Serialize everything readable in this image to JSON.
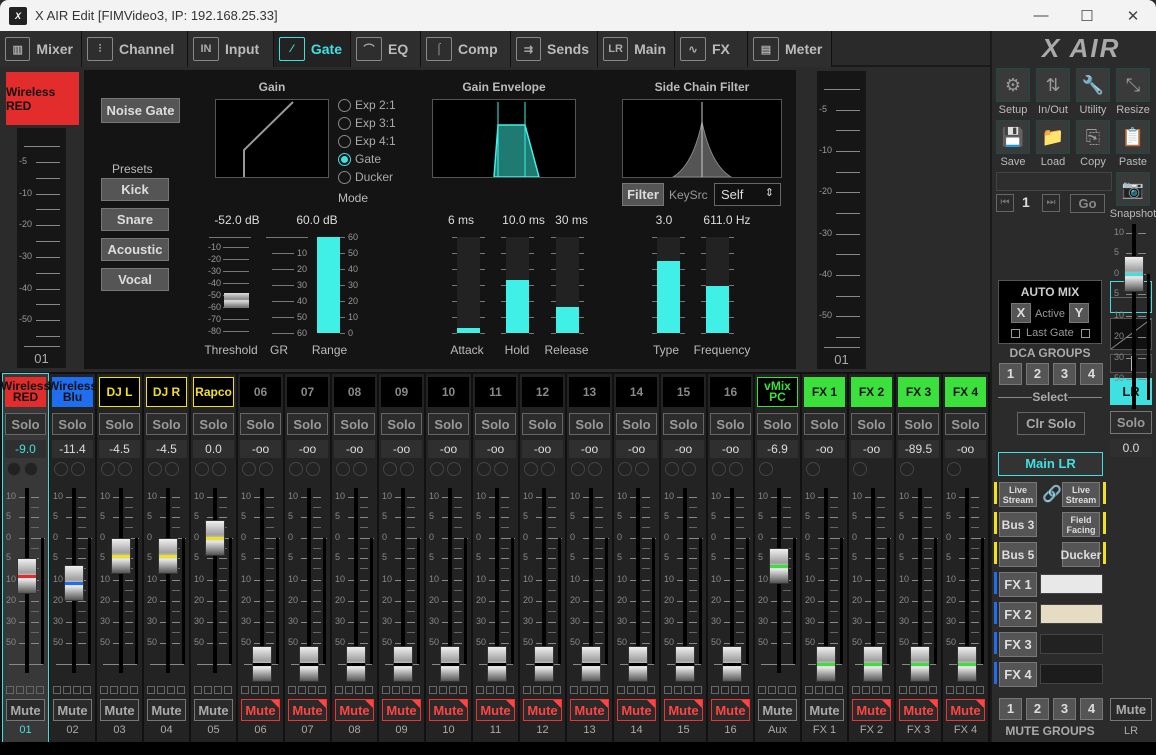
{
  "window": {
    "title": "X AIR Edit [FIMVideo3, IP: 192.168.25.33]",
    "minimize": "—",
    "maximize": "☐",
    "close": "✕"
  },
  "tabs": [
    {
      "label": "Mixer",
      "icon": "mixer-icon",
      "glyph": "▥"
    },
    {
      "label": "Channel",
      "icon": "channel-icon",
      "glyph": "⫶"
    },
    {
      "label": "Input",
      "icon": "input-icon",
      "glyph": "IN"
    },
    {
      "label": "Gate",
      "icon": "gate-icon",
      "glyph": "⁄",
      "active": true
    },
    {
      "label": "EQ",
      "icon": "eq-icon",
      "glyph": "⌒"
    },
    {
      "label": "Comp",
      "icon": "comp-icon",
      "glyph": "⌠"
    },
    {
      "label": "Sends",
      "icon": "sends-icon",
      "glyph": "⇉"
    },
    {
      "label": "Main",
      "icon": "main-icon",
      "glyph": "LR"
    },
    {
      "label": "FX",
      "icon": "fx-icon",
      "glyph": "∿"
    },
    {
      "label": "Meter",
      "icon": "meter-icon",
      "glyph": "▤"
    }
  ],
  "channel": {
    "name": "Wireless RED",
    "number": "01",
    "color": "#e32d2d"
  },
  "meter_scale": [
    "-5",
    "-10",
    "-20",
    "-30",
    "-40",
    "-50"
  ],
  "gate": {
    "noise_gate_label": "Noise Gate",
    "presets_label": "Presets",
    "presets": [
      "Kick",
      "Snare",
      "Acoustic",
      "Vocal"
    ],
    "gain_title": "Gain",
    "envelope_title": "Gain Envelope",
    "sidechain_title": "Side Chain Filter",
    "modes": [
      "Exp 2:1",
      "Exp 3:1",
      "Exp 4:1",
      "Gate",
      "Ducker"
    ],
    "mode_selected": "Gate",
    "mode_label": "Mode",
    "threshold": {
      "label": "Threshold",
      "value": "-52.0 dB",
      "scale": [
        "-10",
        "-20",
        "-30",
        "-40",
        "-50",
        "-60",
        "-70",
        "-80"
      ]
    },
    "gr": {
      "label": "GR",
      "scale": [
        "10",
        "20",
        "30",
        "40",
        "50",
        "60"
      ]
    },
    "range": {
      "label": "Range",
      "value": "60.0 dB",
      "fraction": 1.0,
      "scale": [
        "60",
        "50",
        "40",
        "30",
        "20",
        "10",
        "0"
      ]
    },
    "attack": {
      "label": "Attack",
      "value": "6 ms",
      "fraction": 0.05
    },
    "hold": {
      "label": "Hold",
      "value": "10.0 ms",
      "fraction": 0.55
    },
    "release": {
      "label": "Release",
      "value": "30 ms",
      "fraction": 0.27
    },
    "filter_label": "Filter",
    "keysrc_label": "KeySrc",
    "keysrc_value": "Self",
    "type": {
      "label": "Type",
      "value": "3.0",
      "fraction": 0.75
    },
    "frequency": {
      "label": "Frequency",
      "value": "611.0 Hz",
      "fraction": 0.49
    }
  },
  "strips": [
    {
      "name": "Wireless RED",
      "db": "-9.0",
      "num": "01",
      "color": "#e32d2d",
      "text": "#111",
      "mute": false,
      "sel": true,
      "fader_db": -9.0,
      "stripe": "#e32d2d",
      "knobs": 2,
      "knobfill": true
    },
    {
      "name": "Wireless Blu",
      "db": "-11.4",
      "num": "02",
      "color": "#1f6ef0",
      "text": "#111",
      "mute": false,
      "fader_db": -11.4,
      "stripe": "#1f6ef0",
      "knobs": 2
    },
    {
      "name": "DJ L",
      "db": "-4.5",
      "num": "03",
      "color": "#000",
      "text": "#f0e020",
      "border": "#f0e020",
      "mute": false,
      "fader_db": -4.5,
      "stripe": "#f0e020",
      "knobs": 2
    },
    {
      "name": "DJ R",
      "db": "-4.5",
      "num": "04",
      "color": "#000",
      "text": "#f0e020",
      "border": "#f0e020",
      "mute": false,
      "fader_db": -4.5,
      "stripe": "#f0e020",
      "knobs": 2
    },
    {
      "name": "Rapco",
      "db": "0.0",
      "num": "05",
      "color": "#000",
      "text": "#f0e020",
      "border": "#f0e020",
      "mute": false,
      "fader_db": 0,
      "stripe": "#f0e020",
      "knobs": 2
    },
    {
      "name": "06",
      "db": "-oo",
      "num": "06",
      "mute": true,
      "fader_db": -90,
      "stripe": "#000",
      "knobs": 2
    },
    {
      "name": "07",
      "db": "-oo",
      "num": "07",
      "mute": true,
      "fader_db": -90,
      "stripe": "#000",
      "knobs": 2
    },
    {
      "name": "08",
      "db": "-oo",
      "num": "08",
      "mute": true,
      "fader_db": -90,
      "stripe": "#000",
      "knobs": 2
    },
    {
      "name": "09",
      "db": "-oo",
      "num": "09",
      "mute": true,
      "fader_db": -90,
      "stripe": "#000",
      "knobs": 2
    },
    {
      "name": "10",
      "db": "-oo",
      "num": "10",
      "mute": true,
      "fader_db": -90,
      "stripe": "#000",
      "knobs": 2
    },
    {
      "name": "11",
      "db": "-oo",
      "num": "11",
      "mute": true,
      "fader_db": -90,
      "stripe": "#000",
      "knobs": 2
    },
    {
      "name": "12",
      "db": "-oo",
      "num": "12",
      "mute": true,
      "fader_db": -90,
      "stripe": "#000",
      "knobs": 2
    },
    {
      "name": "13",
      "db": "-oo",
      "num": "13",
      "mute": true,
      "fader_db": -90,
      "stripe": "#000",
      "knobs": 2
    },
    {
      "name": "14",
      "db": "-oo",
      "num": "14",
      "mute": true,
      "fader_db": -90,
      "stripe": "#000",
      "knobs": 2
    },
    {
      "name": "15",
      "db": "-oo",
      "num": "15",
      "mute": true,
      "fader_db": -90,
      "stripe": "#000",
      "knobs": 2
    },
    {
      "name": "16",
      "db": "-oo",
      "num": "16",
      "mute": true,
      "fader_db": -90,
      "stripe": "#000",
      "knobs": 2
    },
    {
      "name": "vMix PC",
      "db": "-6.9",
      "num": "Aux",
      "color": "#000",
      "text": "#3ce03c",
      "border": "#3ce03c",
      "mute": false,
      "fader_db": -6.9,
      "stripe": "#3ce03c",
      "knobs": 1
    },
    {
      "name": "FX 1",
      "db": "-oo",
      "num": "FX 1",
      "color": "#3ce03c",
      "text": "#111",
      "mute": false,
      "fader_db": -90,
      "stripe": "#3ce03c",
      "knobs": 1
    },
    {
      "name": "FX 2",
      "db": "-oo",
      "num": "FX 2",
      "color": "#3ce03c",
      "text": "#111",
      "mute": true,
      "fader_db": -90,
      "stripe": "#3ce03c",
      "knobs": 1
    },
    {
      "name": "FX 3",
      "db": "-89.5",
      "num": "FX 3",
      "color": "#3ce03c",
      "text": "#111",
      "mute": true,
      "fader_db": -89.5,
      "stripe": "#3ce03c",
      "knobs": 1
    },
    {
      "name": "FX 4",
      "db": "-oo",
      "num": "FX 4",
      "color": "#3ce03c",
      "text": "#111",
      "mute": true,
      "fader_db": -90,
      "stripe": "#3ce03c",
      "knobs": 1
    }
  ],
  "strip_labels": {
    "solo": "Solo",
    "mute": "Mute"
  },
  "fader_scale": [
    "10",
    "5",
    "0",
    "5",
    "10",
    "20",
    "30",
    "50"
  ],
  "right": {
    "logo": "X AIR",
    "tools": [
      {
        "label": "Setup",
        "icon": "setup-icon",
        "glyph": "⚙"
      },
      {
        "label": "In/Out",
        "icon": "in-out-icon",
        "glyph": "⇅"
      },
      {
        "label": "Utility",
        "icon": "utility-icon",
        "glyph": "🔧"
      },
      {
        "label": "Resize",
        "icon": "resize-icon",
        "glyph": "⤡"
      },
      {
        "label": "Save",
        "icon": "save-icon",
        "glyph": "💾"
      },
      {
        "label": "Load",
        "icon": "load-icon",
        "glyph": "📁"
      },
      {
        "label": "Copy",
        "icon": "copy-icon",
        "glyph": "⎘"
      },
      {
        "label": "Paste",
        "icon": "paste-icon",
        "glyph": "📋"
      }
    ],
    "snapshot_number": "1",
    "go_label": "Go",
    "snapshot_label": "Snapshot",
    "automix": {
      "title": "AUTO MIX",
      "x": "X",
      "active": "Active",
      "y": "Y",
      "last_gate": "Last Gate"
    },
    "dca_title": "DCA GROUPS",
    "dca": [
      "1",
      "2",
      "3",
      "4"
    ],
    "select_label": "Select",
    "clr_solo": "Clr Solo",
    "main_lr": "Main LR",
    "buses": [
      {
        "left": "Live Stream",
        "right": "Live Stream",
        "linked": true
      },
      {
        "left": "Bus 3",
        "right": "Field Facing"
      },
      {
        "left": "Bus 5",
        "right": "Ducker"
      }
    ],
    "fx": [
      "FX 1",
      "FX 2",
      "FX 3",
      "FX 4"
    ],
    "mute_groups": [
      "1",
      "2",
      "3",
      "4"
    ],
    "mute_groups_title": "MUTE GROUPS",
    "lr": {
      "name": "LR",
      "db": "0.0",
      "num": "LR",
      "fader_db": 0
    }
  }
}
